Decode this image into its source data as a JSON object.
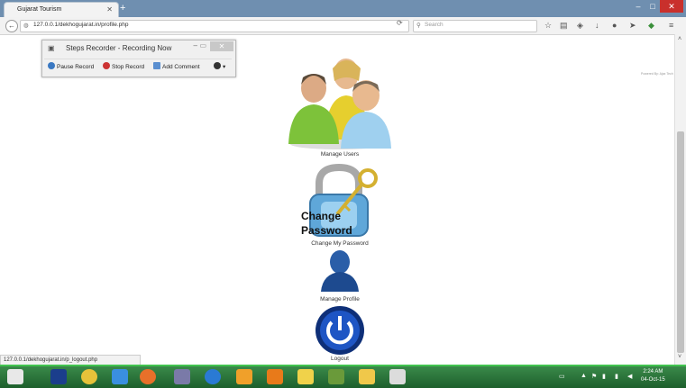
{
  "browser": {
    "tab_title": "Gujarat Tourism",
    "url": "127.0.0.1/dekhogujarat.in/profile.php",
    "search_placeholder": "Search",
    "status_url": "127.0.0.1/dekhogujarat.in/p_logout.php"
  },
  "steps_recorder": {
    "title": "Steps Recorder - Recording Now",
    "pause": "Pause Record",
    "stop": "Stop Record",
    "comment": "Add Comment"
  },
  "page": {
    "powered": "Powered By: Ajax Tech",
    "manage_users": "Manage Users",
    "change_password_img_line1": "Change",
    "change_password_img_line2": "Password",
    "change_password": "Change My Password",
    "manage_profile": "Manage Profile",
    "logout": "Logout"
  },
  "taskbar": {
    "time": "2:24 AM",
    "date": "04-Oct-15"
  },
  "colors": {
    "taskbar": "#2d7a3c",
    "titlebar": "#6f8fb0",
    "close_red": "#c9302c"
  }
}
